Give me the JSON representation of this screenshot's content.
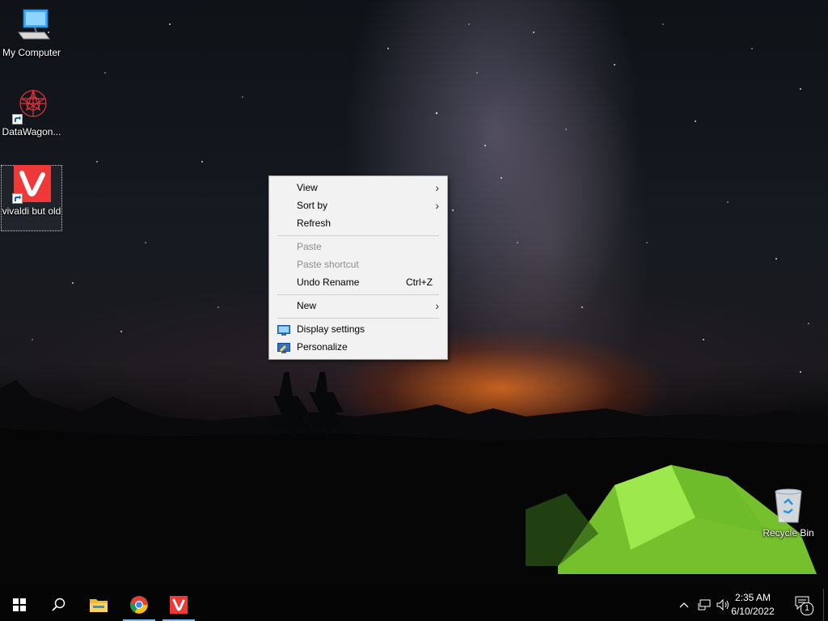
{
  "desktop": {
    "icons": [
      {
        "label": "My Computer"
      },
      {
        "label": "DataWagon..."
      },
      {
        "label": "vivaldi but old"
      },
      {
        "label": "Recycle Bin"
      }
    ]
  },
  "context_menu": {
    "view": "View",
    "sort_by": "Sort by",
    "refresh": "Refresh",
    "paste": "Paste",
    "paste_shortcut": "Paste shortcut",
    "undo_rename": "Undo Rename",
    "undo_shortcut": "Ctrl+Z",
    "new": "New",
    "display_settings": "Display settings",
    "personalize": "Personalize"
  },
  "taskbar": {
    "apps": [
      "start",
      "search",
      "file-explorer",
      "chrome",
      "vivaldi"
    ],
    "clock_time": "2:35 AM",
    "clock_date": "6/10/2022",
    "notification_count": "1"
  },
  "colors": {
    "vivaldi_red": "#ef3939",
    "taskbar_accent": "#76b9ed",
    "tent_green": "#8ee03a"
  }
}
